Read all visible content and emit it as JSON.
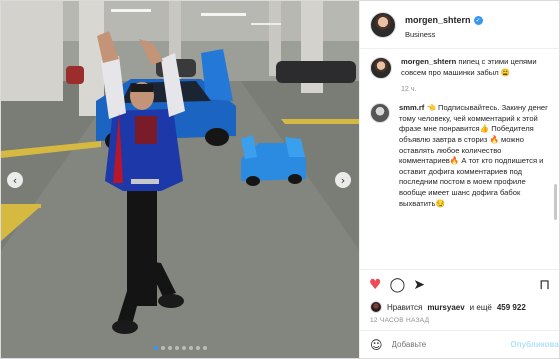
{
  "post": {
    "author": "morgen_shtern",
    "author_subtitle": "Business",
    "caption": {
      "user": "morgen_shtern",
      "text": "пипец с этими цепями совсем про машинки забыл 😩",
      "time": "12 ч."
    },
    "comments": [
      {
        "user": "smm.rf",
        "text": "👈 Подписывайтесь. Закину денег тому человеку, чей комментарий к этой фразе мне понравится👍 Победителя объявлю завтра в сториз 🔥 можно оставлять любое количество комментариев🔥 А тот кто подпишется и оставит дофига комментариев под последним постом в моем профиле вообще имеет шанс дофига бабок выхватить😏"
      }
    ],
    "likes": {
      "prefix": "Нравится",
      "user": "mursyaev",
      "middle": "и ещё",
      "count": "459 922"
    },
    "posted_ago": "12 ЧАСОВ НАЗАД",
    "comment_input": {
      "placeholder": "Добавьте комментарий...",
      "display": "Добавьте"
    },
    "publish_label": "Опубликовать",
    "carousel": {
      "total": 8,
      "active_index": 0
    },
    "icons": {
      "like": "heart-icon",
      "comment": "comment-icon",
      "share": "share-icon",
      "save": "bookmark-icon",
      "emoji": "emoji-icon",
      "prev": "chevron-left-icon",
      "next": "chevron-right-icon",
      "verified": "verified-badge-icon"
    },
    "colors": {
      "like_active": "#ed4956",
      "verified": "#3897f0",
      "publish_disabled": "#b2dffc",
      "active_dot": "#3897f0"
    }
  }
}
